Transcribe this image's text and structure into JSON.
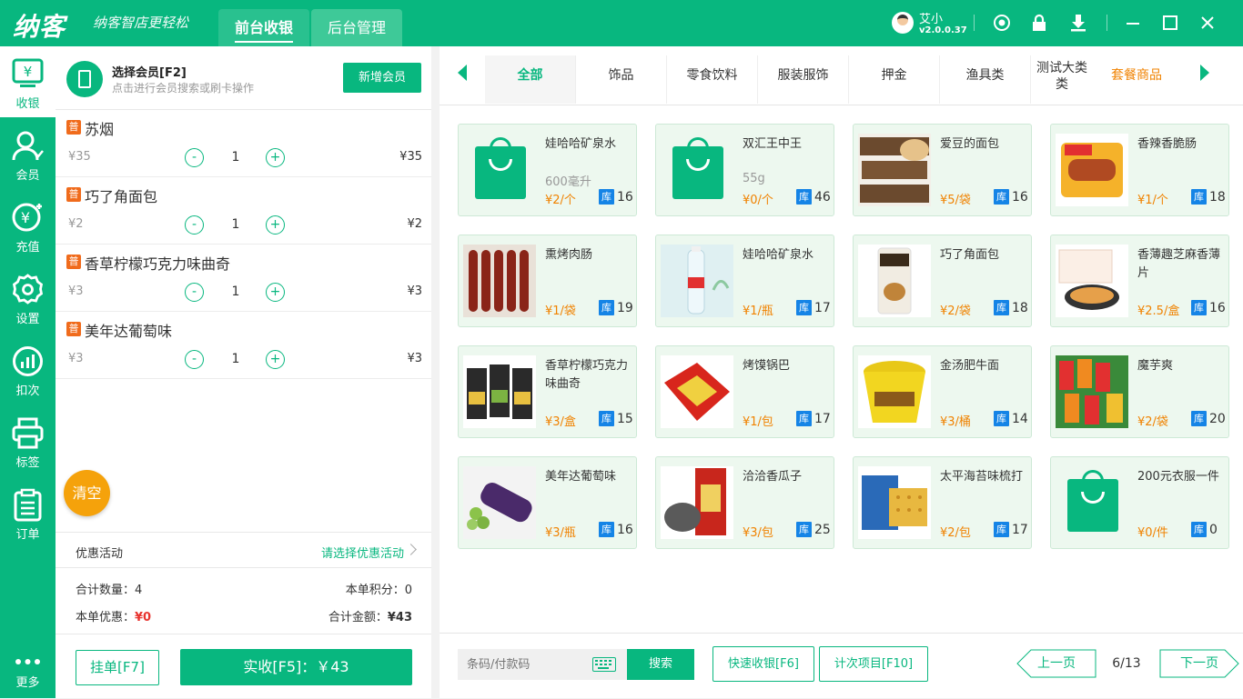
{
  "app": {
    "logo": "纳客",
    "slogan": "纳客智店更轻松"
  },
  "topnav": {
    "tab1": "前台收银",
    "tab2": "后台管理"
  },
  "user": {
    "name": "艾小",
    "version": "v2.0.0.37"
  },
  "sidebar": [
    {
      "label": "收银",
      "icon": "cashier-icon"
    },
    {
      "label": "会员",
      "icon": "member-icon"
    },
    {
      "label": "充值",
      "icon": "recharge-icon"
    },
    {
      "label": "设置",
      "icon": "settings-icon"
    },
    {
      "label": "扣次",
      "icon": "deduct-icon"
    },
    {
      "label": "标签",
      "icon": "printer-icon"
    },
    {
      "label": "订单",
      "icon": "order-icon"
    },
    {
      "label": "更多",
      "icon": "more-icon"
    }
  ],
  "member": {
    "title": "选择会员[F2]",
    "subtitle": "点击进行会员搜索或刷卡操作",
    "new_btn": "新增会员"
  },
  "cart": {
    "badge": "普",
    "items": [
      {
        "name": "苏烟",
        "unit": "¥35",
        "qty": "1",
        "total": "¥35"
      },
      {
        "name": "巧了角面包",
        "unit": "¥2",
        "qty": "1",
        "total": "¥2"
      },
      {
        "name": "香草柠檬巧克力味曲奇",
        "unit": "¥3",
        "qty": "1",
        "total": "¥3"
      },
      {
        "name": "美年达葡萄味",
        "unit": "¥3",
        "qty": "1",
        "total": "¥3"
      }
    ],
    "minus": "-",
    "plus": "+",
    "clear": "清空"
  },
  "promo": {
    "label": "优惠活动",
    "select": "请选择优惠活动"
  },
  "summary": {
    "count_label": "合计数量：",
    "count": "4",
    "points_label": "本单积分：",
    "points": "0",
    "discount_label": "本单优惠：",
    "discount": "¥0",
    "amount_label": "合计金额：",
    "amount": "¥43"
  },
  "actions": {
    "hold": "挂单[F7]",
    "pay": "实收[F5]：￥43"
  },
  "categories": [
    "全部",
    "饰品",
    "零食饮料",
    "服装服饰",
    "押金",
    "渔具类",
    "测试大类类",
    "套餐商品"
  ],
  "products": [
    {
      "name": "娃哈哈矿泉水",
      "spec": "600毫升",
      "price": "¥2/个",
      "stock": "16",
      "img": "bag"
    },
    {
      "name": "双汇王中王",
      "spec": "55g",
      "price": "¥0/个",
      "stock": "46",
      "img": "bag"
    },
    {
      "name": "爱豆的面包",
      "spec": "",
      "price": "¥5/袋",
      "stock": "16",
      "img": "bread"
    },
    {
      "name": "香辣香脆肠",
      "spec": "",
      "price": "¥1/个",
      "stock": "18",
      "img": "sausage"
    },
    {
      "name": "熏烤肉肠",
      "spec": "",
      "price": "¥1/袋",
      "stock": "19",
      "img": "meat"
    },
    {
      "name": "娃哈哈矿泉水",
      "spec": "",
      "price": "¥1/瓶",
      "stock": "17",
      "img": "water"
    },
    {
      "name": "巧了角面包",
      "spec": "",
      "price": "¥2/袋",
      "stock": "18",
      "img": "croissant"
    },
    {
      "name": "香薄趣芝麻香薄片",
      "spec": "",
      "price": "¥2.5/盒",
      "stock": "16",
      "img": "biscuit"
    },
    {
      "name": "香草柠檬巧克力味曲奇",
      "spec": "",
      "price": "¥3/盒",
      "stock": "15",
      "img": "cookie"
    },
    {
      "name": "烤馍锅巴",
      "spec": "",
      "price": "¥1/包",
      "stock": "17",
      "img": "snack"
    },
    {
      "name": "金汤肥牛面",
      "spec": "",
      "price": "¥3/桶",
      "stock": "14",
      "img": "noodle"
    },
    {
      "name": "魔芋爽",
      "spec": "",
      "price": "¥2/袋",
      "stock": "20",
      "img": "konjac"
    },
    {
      "name": "美年达葡萄味",
      "spec": "",
      "price": "¥3/瓶",
      "stock": "16",
      "img": "grape"
    },
    {
      "name": "洽洽香瓜子",
      "spec": "",
      "price": "¥3/包",
      "stock": "25",
      "img": "seeds"
    },
    {
      "name": "太平海苔味梳打",
      "spec": "",
      "price": "¥2/包",
      "stock": "17",
      "img": "cracker"
    },
    {
      "name": "200元衣服一件",
      "spec": "",
      "price": "¥0/件",
      "stock": "0",
      "img": "bag"
    }
  ],
  "stock_badge": "库",
  "bottom": {
    "barcode_placeholder": "条码/付款码",
    "search": "搜索",
    "quick": "快速收银[F6]",
    "count_item": "计次项目[F10]",
    "prev": "上一页",
    "page": "6/13",
    "next": "下一页"
  },
  "colors": {
    "brand": "#08b77f",
    "price": "#f08200",
    "stock": "#1584e6",
    "badge": "#f06b1c",
    "clear": "#f5a20b"
  }
}
